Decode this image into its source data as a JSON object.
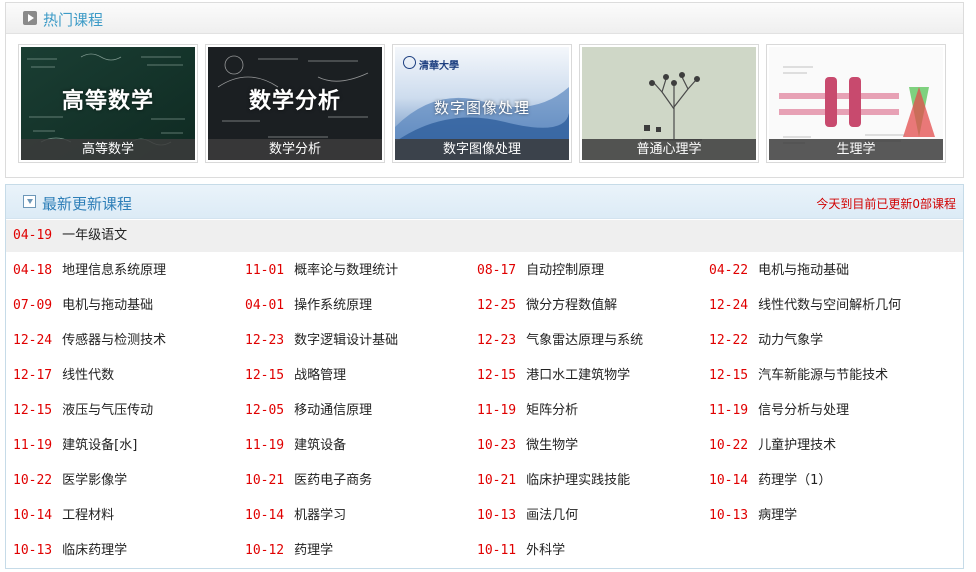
{
  "hot": {
    "title": "热门课程",
    "cards": [
      {
        "title": "高等数学",
        "caption": "高等数学"
      },
      {
        "title": "数学分析",
        "caption": "数学分析"
      },
      {
        "title": "数字图像处理",
        "caption": "数字图像处理",
        "logo": "清華大學"
      },
      {
        "title": "",
        "caption": "普通心理学"
      },
      {
        "title": "",
        "caption": "生理学"
      }
    ]
  },
  "latest": {
    "title": "最新更新课程",
    "today_note": "今天到目前已更新0部课程",
    "courses": [
      {
        "date": "04-19",
        "name": "一年级语文"
      },
      {
        "date": "04-18",
        "name": "地理信息系统原理"
      },
      {
        "date": "11-01",
        "name": "概率论与数理统计"
      },
      {
        "date": "08-17",
        "name": "自动控制原理"
      },
      {
        "date": "04-22",
        "name": "电机与拖动基础"
      },
      {
        "date": "07-09",
        "name": "电机与拖动基础"
      },
      {
        "date": "04-01",
        "name": "操作系统原理"
      },
      {
        "date": "12-25",
        "name": "微分方程数值解"
      },
      {
        "date": "12-24",
        "name": "线性代数与空间解析几何"
      },
      {
        "date": "12-24",
        "name": "传感器与检测技术"
      },
      {
        "date": "12-23",
        "name": "数字逻辑设计基础"
      },
      {
        "date": "12-23",
        "name": "气象雷达原理与系统"
      },
      {
        "date": "12-22",
        "name": "动力气象学"
      },
      {
        "date": "12-17",
        "name": "线性代数"
      },
      {
        "date": "12-15",
        "name": "战略管理"
      },
      {
        "date": "12-15",
        "name": "港口水工建筑物学"
      },
      {
        "date": "12-15",
        "name": "汽车新能源与节能技术"
      },
      {
        "date": "12-15",
        "name": "液压与气压传动"
      },
      {
        "date": "12-05",
        "name": "移动通信原理"
      },
      {
        "date": "11-19",
        "name": "矩阵分析"
      },
      {
        "date": "11-19",
        "name": "信号分析与处理"
      },
      {
        "date": "11-19",
        "name": "建筑设备[水]"
      },
      {
        "date": "11-19",
        "name": "建筑设备"
      },
      {
        "date": "10-23",
        "name": "微生物学"
      },
      {
        "date": "10-22",
        "name": "儿童护理技术"
      },
      {
        "date": "10-22",
        "name": "医学影像学"
      },
      {
        "date": "10-21",
        "name": "医药电子商务"
      },
      {
        "date": "10-21",
        "name": "临床护理实践技能"
      },
      {
        "date": "10-14",
        "name": "药理学（1）"
      },
      {
        "date": "10-14",
        "name": "工程材料"
      },
      {
        "date": "10-14",
        "name": "机器学习"
      },
      {
        "date": "10-13",
        "name": "画法几何"
      },
      {
        "date": "10-13",
        "name": "病理学"
      },
      {
        "date": "10-13",
        "name": "临床药理学"
      },
      {
        "date": "10-12",
        "name": "药理学"
      },
      {
        "date": "10-11",
        "name": "外科学"
      }
    ]
  }
}
